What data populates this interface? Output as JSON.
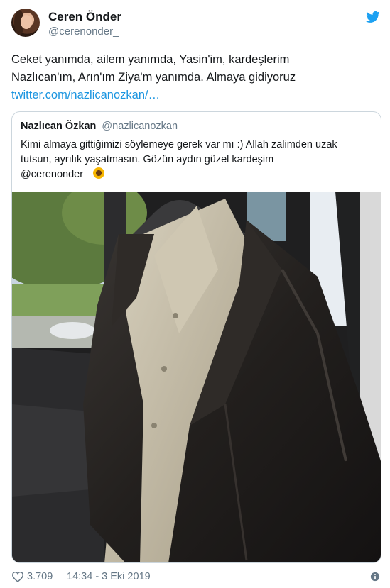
{
  "author": {
    "display_name": "Ceren Önder",
    "handle": "@cerenonder_"
  },
  "tweet": {
    "lines": [
      "Ceket yanımda, ailem yanımda, Yasin'im, kardeşlerim",
      "Nazlıcan'ım, Arın'ım Ziya'm yanımda. Almaya gidiyoruz"
    ],
    "link": "twitter.com/nazlicanozkan/…"
  },
  "quote": {
    "display_name": "Nazlıcan Özkan",
    "handle": "@nazlicanozkan",
    "lines": [
      "Kimi almaya gittiğimizi söylemeye gerek var mı :) Allah zalimden uzak",
      "tutsun, ayrılık yaşatmasın. Gözün aydın güzel kardeşim",
      "@cerenonder_"
    ]
  },
  "footer": {
    "likes": "3.709",
    "timestamp": "14:34 - 3 Eki 2019"
  },
  "icons": {
    "brand": "twitter-bird-icon",
    "like": "heart-icon",
    "info": "info-icon",
    "emoji": "sunflower-icon"
  },
  "colors": {
    "brand": "#1da1f2",
    "link": "#1b95e0",
    "secondary_text": "#657786",
    "border": "#ccd6dd"
  }
}
